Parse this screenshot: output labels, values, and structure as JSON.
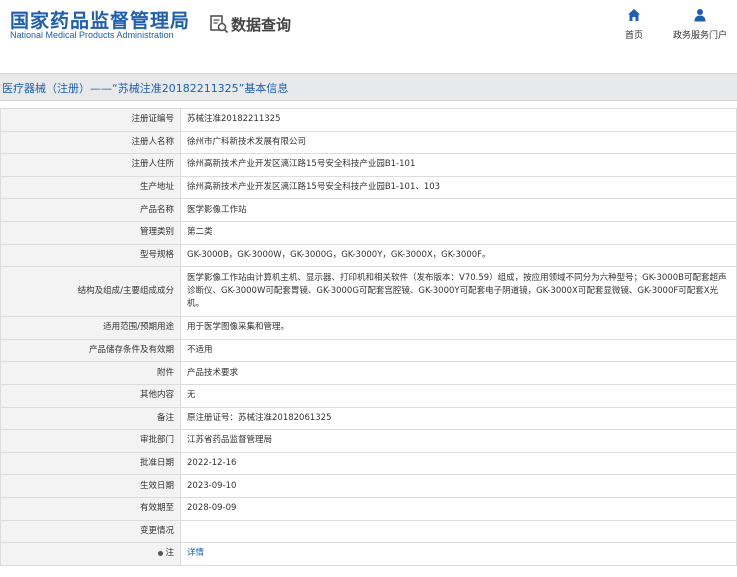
{
  "header": {
    "logo_cn": "国家药品监督管理局",
    "logo_en": "National Medical Products Administration",
    "query_title": "数据查询",
    "nav": {
      "home_label": "首页",
      "gov_label": "政务服务门户"
    }
  },
  "colors": {
    "brand": "#1f5fae",
    "title_bar_bg": "#e8e9ea",
    "key_bg": "#f3f3f3"
  },
  "icons": {
    "query": "search-document-icon",
    "home": "home-icon",
    "user": "user-icon",
    "note": "dot-icon"
  },
  "title": "医疗器械（注册）——“苏械注准20182211325”基本信息",
  "rows": [
    {
      "key": "注册证编号",
      "value": "苏械注准20182211325"
    },
    {
      "key": "注册人名称",
      "value": "徐州市广科新技术发展有限公司"
    },
    {
      "key": "注册人住所",
      "value": "徐州高新技术产业开发区漓江路15号安全科技产业园B1-101"
    },
    {
      "key": "生产地址",
      "value": "徐州高新技术产业开发区漓江路15号安全科技产业园B1-101、103"
    },
    {
      "key": "产品名称",
      "value": "医学影像工作站"
    },
    {
      "key": "管理类别",
      "value": "第二类"
    },
    {
      "key": "型号规格",
      "value": "GK-3000B，GK-3000W，GK-3000G，GK-3000Y，GK-3000X，GK-3000F。"
    },
    {
      "key": "结构及组成/主要组成成分",
      "value": "医学影像工作站由计算机主机、显示器、打印机和相关软件（发布版本：V70.59）组成，按应用领域不同分为六种型号；GK-3000B可配套超声诊断仪、GK-3000W可配套胃镜、GK-3000G可配套宫腔镜、GK-3000Y可配套电子阴道镜，GK-3000X可配套显微镜、GK-3000F可配套X光机。"
    },
    {
      "key": "适用范围/预期用途",
      "value": "用于医学图像采集和管理。"
    },
    {
      "key": "产品储存条件及有效期",
      "value": "不适用"
    },
    {
      "key": "附件",
      "value": "产品技术要求"
    },
    {
      "key": "其他内容",
      "value": "无"
    },
    {
      "key": "备注",
      "value": "原注册证号：苏械注准20182061325"
    },
    {
      "key": "审批部门",
      "value": "江苏省药品监督管理局"
    },
    {
      "key": "批准日期",
      "value": "2022-12-16"
    },
    {
      "key": "生效日期",
      "value": "2023-09-10"
    },
    {
      "key": "有效期至",
      "value": "2028-09-09"
    },
    {
      "key": "变更情况",
      "value": ""
    },
    {
      "key": "注",
      "value": "详情"
    }
  ]
}
